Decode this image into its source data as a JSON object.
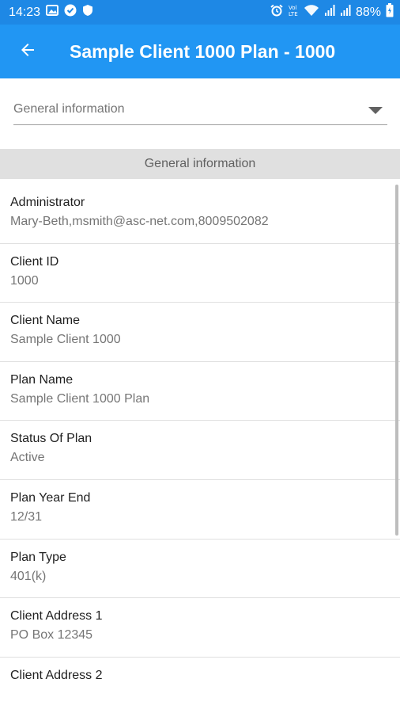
{
  "status_bar": {
    "time": "14:23",
    "battery": "88%",
    "icons_left": [
      "image-icon",
      "app-notification-icon",
      "shield-icon"
    ],
    "icons_right": [
      "alarm-icon",
      "volte-icon",
      "wifi-icon",
      "signal-icon",
      "signal-icon",
      "battery-icon"
    ]
  },
  "app_bar": {
    "title": "Sample Client 1000 Plan - 1000",
    "back_icon": "arrow-left-icon",
    "color": "#2196f3"
  },
  "dropdown": {
    "selected": "General information",
    "icon": "triangle-down-icon"
  },
  "section": {
    "title": "General information"
  },
  "fields": [
    {
      "label": "Administrator",
      "value": "Mary-Beth,msmith@asc-net.com,8009502082"
    },
    {
      "label": "Client ID",
      "value": "1000"
    },
    {
      "label": "Client Name",
      "value": "Sample Client 1000"
    },
    {
      "label": "Plan Name",
      "value": "Sample Client 1000 Plan"
    },
    {
      "label": "Status Of Plan",
      "value": "Active"
    },
    {
      "label": "Plan Year End",
      "value": "12/31"
    },
    {
      "label": "Plan Type",
      "value": "401(k)"
    },
    {
      "label": "Client Address 1",
      "value": "PO Box 12345"
    },
    {
      "label": "Client Address 2",
      "value": ""
    }
  ]
}
